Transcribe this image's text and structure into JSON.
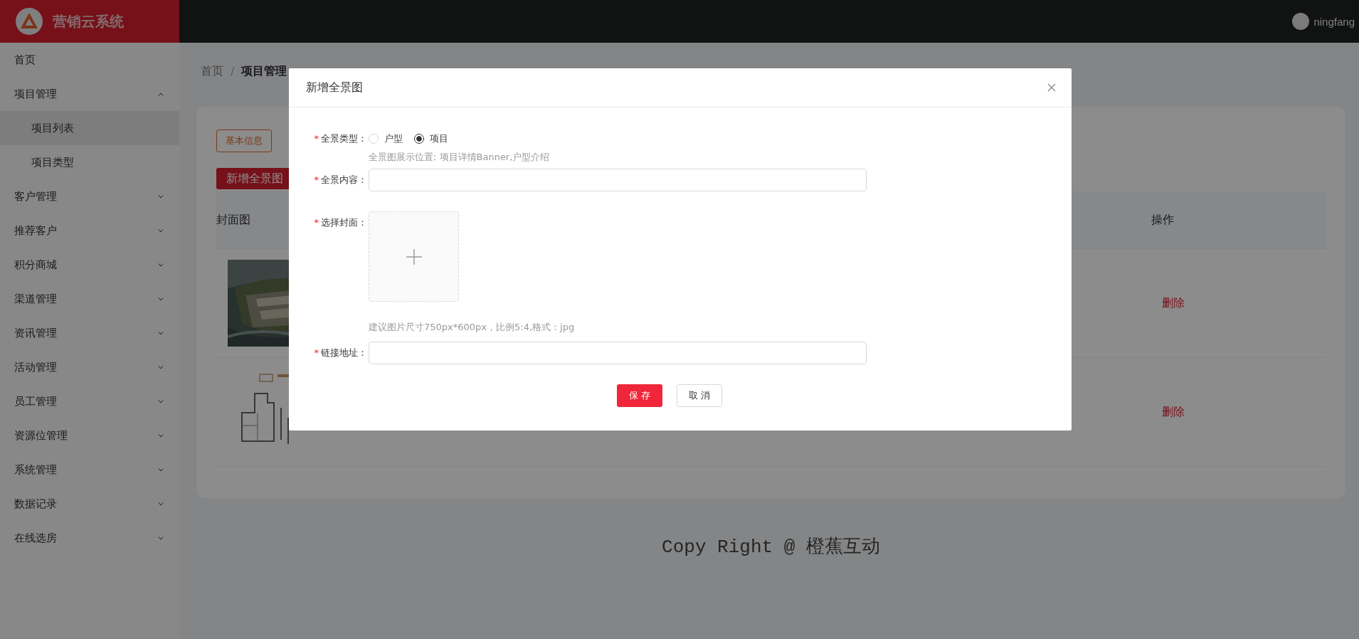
{
  "header": {
    "logo_text": "营销云系统",
    "user": "ningfang"
  },
  "sidebar": {
    "items": [
      {
        "kind": "link",
        "label": "首页"
      },
      {
        "kind": "group",
        "label": "项目管理",
        "expanded": true,
        "children": [
          {
            "label": "项目列表",
            "selected": true
          },
          {
            "label": "项目类型",
            "selected": false
          }
        ]
      },
      {
        "kind": "group",
        "label": "客户管理",
        "expanded": false
      },
      {
        "kind": "group",
        "label": "推荐客户",
        "expanded": false
      },
      {
        "kind": "group",
        "label": "积分商城",
        "expanded": false
      },
      {
        "kind": "group",
        "label": "渠道管理",
        "expanded": false
      },
      {
        "kind": "group",
        "label": "资讯管理",
        "expanded": false
      },
      {
        "kind": "group",
        "label": "活动管理",
        "expanded": false
      },
      {
        "kind": "group",
        "label": "员工管理",
        "expanded": false
      },
      {
        "kind": "group",
        "label": "资源位管理",
        "expanded": false
      },
      {
        "kind": "group",
        "label": "系统管理",
        "expanded": false
      },
      {
        "kind": "group",
        "label": "数据记录",
        "expanded": false
      },
      {
        "kind": "group",
        "label": "在线选房",
        "expanded": false
      }
    ]
  },
  "breadcrumb": {
    "separator": "/",
    "items": [
      "首页",
      "项目管理"
    ]
  },
  "tabs": [
    {
      "label": "基本信息",
      "selected": true
    }
  ],
  "add_button": "新增全景图",
  "table": {
    "columns": [
      "封面图",
      "操作"
    ],
    "rows": [
      {
        "action": "删除"
      },
      {
        "action": "删除"
      }
    ]
  },
  "footer": "Copy Right @ 橙蕉互动",
  "modal": {
    "title": "新增全景图",
    "fields": [
      {
        "kind": "radio",
        "required_mark": "*",
        "label": "全景类型：",
        "options": [
          {
            "label": "户型",
            "selected": false
          },
          {
            "label": "项目",
            "selected": true
          }
        ],
        "hint": "全景图展示位置: 项目详情Banner,户型介绍"
      },
      {
        "kind": "input",
        "required_mark": "*",
        "label": "全景内容："
      },
      {
        "kind": "upload",
        "required_mark": "*",
        "label": "选择封面：",
        "hint": "建议图片尺寸750px*600px，比例5:4,格式：jpg"
      },
      {
        "kind": "input",
        "required_mark": "*",
        "label": "链接地址："
      }
    ],
    "buttons": [
      {
        "kind": "primary",
        "label": "保 存"
      },
      {
        "kind": "default",
        "label": "取 消"
      }
    ]
  }
}
